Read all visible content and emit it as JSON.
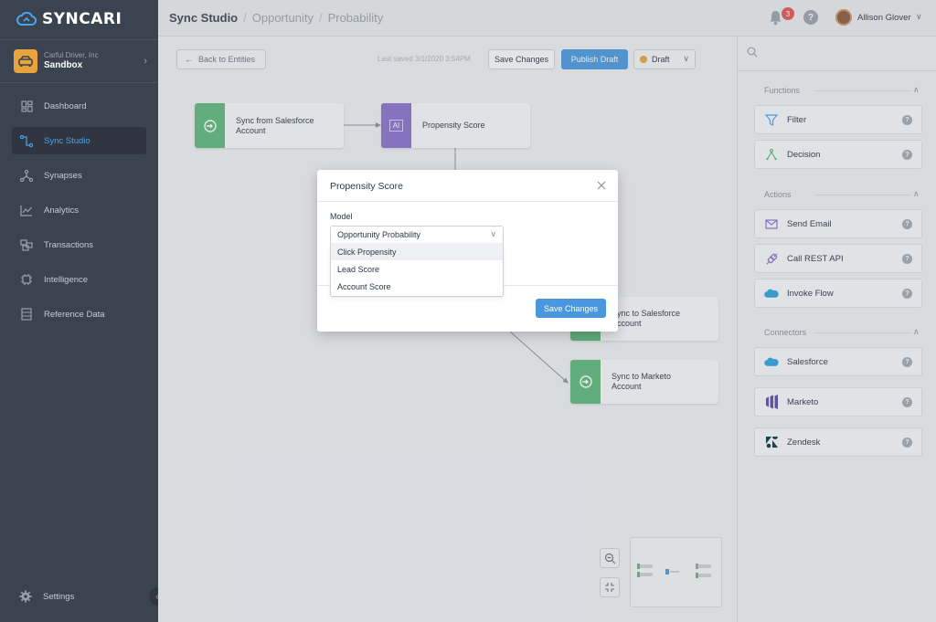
{
  "brand": {
    "logo_text": "SYNCARI",
    "accent": "#4a97dd",
    "sidebar_bg": "#3b4350"
  },
  "org": {
    "name": "Carful Driver, Inc",
    "environment": "Sandbox"
  },
  "nav": {
    "items": [
      {
        "label": "Dashboard",
        "icon": "dashboard-icon"
      },
      {
        "label": "Sync Studio",
        "icon": "sync-studio-icon",
        "active": true
      },
      {
        "label": "Synapses",
        "icon": "synapses-icon"
      },
      {
        "label": "Analytics",
        "icon": "analytics-icon"
      },
      {
        "label": "Transactions",
        "icon": "transactions-icon"
      },
      {
        "label": "Intelligence",
        "icon": "chip-icon"
      },
      {
        "label": "Reference Data",
        "icon": "reference-data-icon"
      }
    ],
    "settings_label": "Settings"
  },
  "header": {
    "breadcrumb": [
      "Sync Studio",
      "Opportunity",
      "Probability"
    ],
    "notifications_count": "3",
    "help_label": "?",
    "user_name": "Allison Glover"
  },
  "toolbar": {
    "back_label": "Back to Entities",
    "last_saved": "Last saved 3/1/2020 3:54PM",
    "save_label": "Save Changes",
    "publish_label": "Publish Draft",
    "status_label": "Draft"
  },
  "canvas": {
    "nodes": [
      {
        "label": "Sync from Salesforce Account",
        "color": "#5cb87a"
      },
      {
        "label": "Propensity Score",
        "icon_text": "AI",
        "color": "#8a6fce"
      },
      {
        "label": "Sync to Salesforce Account",
        "color": "#5cb87a"
      },
      {
        "label": "Sync to Marketo Account",
        "color": "#5cb87a"
      }
    ]
  },
  "panel": {
    "sections": [
      {
        "title": "Functions",
        "items": [
          {
            "label": "Filter"
          },
          {
            "label": "Decision"
          }
        ]
      },
      {
        "title": "Actions",
        "items": [
          {
            "label": "Send Email"
          },
          {
            "label": "Call REST API"
          },
          {
            "label": "Invoke Flow"
          }
        ]
      },
      {
        "title": "Connectors",
        "items": [
          {
            "label": "Salesforce"
          },
          {
            "label": "Marketo"
          },
          {
            "label": "Zendesk"
          }
        ]
      }
    ]
  },
  "modal": {
    "title": "Propensity Score",
    "model_label": "Model",
    "selected": "Opportunity Probability",
    "options": [
      "Click Propensity",
      "Lead Score",
      "Account Score"
    ],
    "save_label": "Save Changes"
  }
}
